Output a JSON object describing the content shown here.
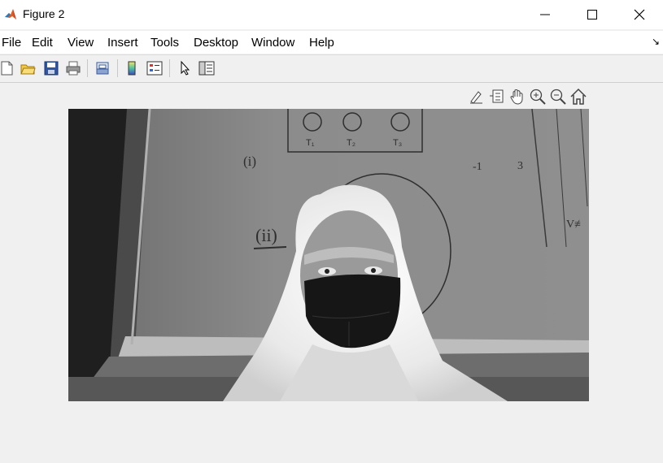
{
  "window": {
    "title": "Figure 2"
  },
  "menu": [
    "File",
    "Edit",
    "View",
    "Insert",
    "Tools",
    "Desktop",
    "Window",
    "Help"
  ],
  "toolbar": [
    "new-figure-icon",
    "open-file-icon",
    "save-icon",
    "print-icon",
    "link-plot-icon",
    "colorbar-icon",
    "legend-icon",
    "edit-plot-icon",
    "property-inspector-icon"
  ],
  "axes_toolbar": [
    "brush-icon",
    "data-tips-icon",
    "pan-icon",
    "zoom-in-icon",
    "zoom-out-icon",
    "restore-view-icon"
  ],
  "image": {
    "description_handwriting": [
      "(i)",
      "(ii)",
      "T₁",
      "T₂",
      "T₃",
      "V≢"
    ]
  }
}
